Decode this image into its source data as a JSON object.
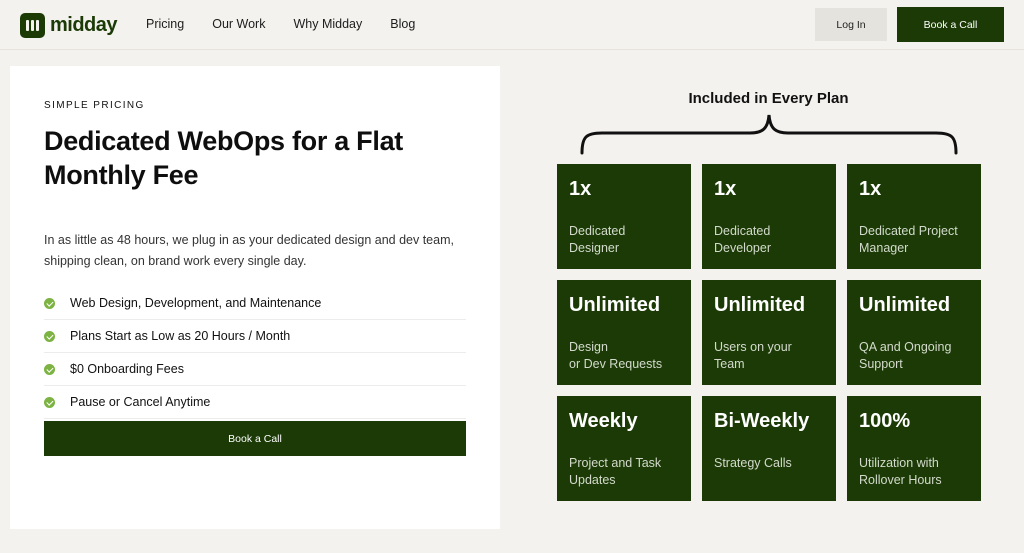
{
  "brand": {
    "name": "midday"
  },
  "nav": {
    "items": [
      {
        "label": "Pricing"
      },
      {
        "label": "Our Work"
      },
      {
        "label": "Why Midday"
      },
      {
        "label": "Blog"
      }
    ],
    "login_label": "Log In",
    "cta_label": "Book a Call"
  },
  "hero": {
    "eyebrow": "SIMPLE PRICING",
    "title": "Dedicated WebOps for a Flat Monthly Fee",
    "description": "In as little as 48 hours, we plug in as your dedicated design and dev team, shipping clean, on brand work every single day.",
    "features": [
      {
        "text": "Web Design, Development, and Maintenance"
      },
      {
        "text": "Plans Start as Low as 20 Hours / Month"
      },
      {
        "text": "$0 Onboarding Fees"
      },
      {
        "text": "Pause or Cancel Anytime"
      }
    ],
    "cta_label": "Book a Call"
  },
  "plan": {
    "title": "Included in Every Plan",
    "tiles": [
      {
        "big": "1x",
        "sub": "Dedicated\nDesigner"
      },
      {
        "big": "1x",
        "sub": "Dedicated\nDeveloper"
      },
      {
        "big": "1x",
        "sub": "Dedicated Project\nManager"
      },
      {
        "big": "Unlimited",
        "sub": "Design\nor Dev Requests"
      },
      {
        "big": "Unlimited",
        "sub": "Users on your\nTeam"
      },
      {
        "big": "Unlimited",
        "sub": "QA and Ongoing\nSupport"
      },
      {
        "big": "Weekly",
        "sub": "Project and Task\nUpdates"
      },
      {
        "big": "Bi-Weekly",
        "sub": "Strategy Calls"
      },
      {
        "big": "100%",
        "sub": "Utilization with\nRollover Hours"
      }
    ]
  },
  "colors": {
    "brand_green": "#1b3a06",
    "check_green": "#7cb342",
    "background": "#f4f2ee"
  }
}
